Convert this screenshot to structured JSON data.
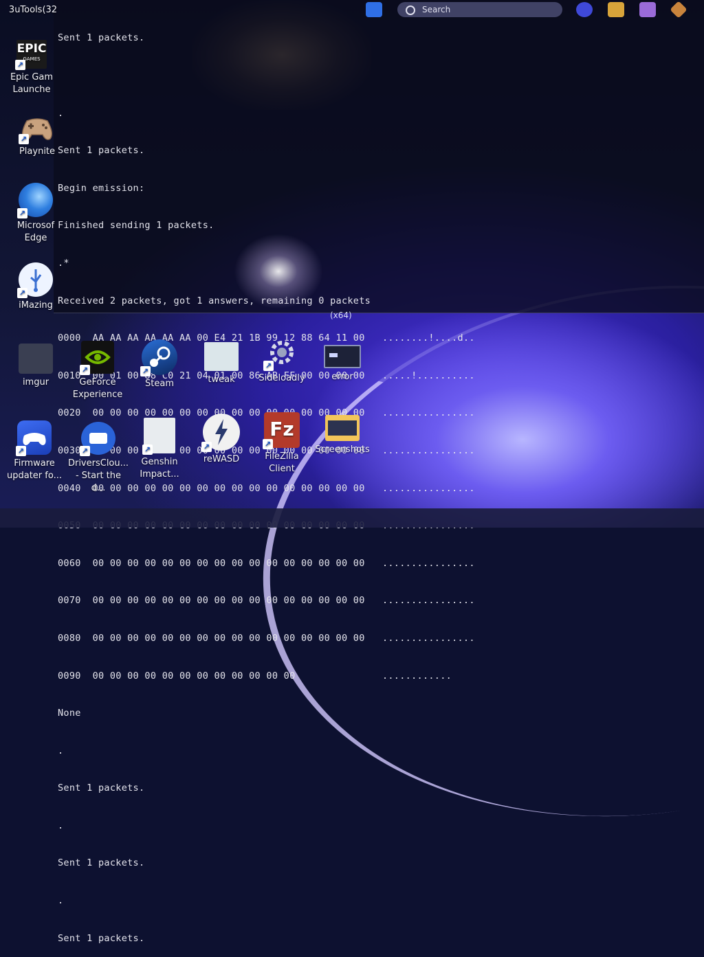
{
  "terminal": {
    "lines": [
      "Sent 1 packets.",
      "",
      ".",
      "Sent 1 packets.",
      "Begin emission:",
      "Finished sending 1 packets.",
      ".*",
      "Received 2 packets, got 1 answers, remaining 0 packets",
      "0000  AA AA AA AA AA AA 00 E4 21 1B 99 12 88 64 11 00   ........!....d..",
      "0010  00 01 00 88 C0 21 04 01 00 86 AB FF 00 00 00 00   .....!..........",
      "0020  00 00 00 00 00 00 00 00 00 00 00 00 00 00 00 00   ................",
      "0030  00 00 00 00 00 00 00 00 00 00 00 00 00 00 00 00   ................",
      "0040  00 00 00 00 00 00 00 00 00 00 00 00 00 00 00 00   ................",
      "0050  00 00 00 00 00 00 00 00 00 00 00 00 00 00 00 00   ................",
      "0060  00 00 00 00 00 00 00 00 00 00 00 00 00 00 00 00   ................",
      "0070  00 00 00 00 00 00 00 00 00 00 00 00 00 00 00 00   ................",
      "0080  00 00 00 00 00 00 00 00 00 00 00 00 00 00 00 00   ................",
      "0090  00 00 00 00 00 00 00 00 00 00 00 00               ............",
      "None",
      ".",
      "Sent 1 packets.",
      ".",
      "Sent 1 packets.",
      ".",
      "Sent 1 packets.",
      "."
    ],
    "window_label": "(x64)"
  },
  "desktop_left": [
    {
      "name": "3uTools(32",
      "icon": "3utools-icon"
    },
    {
      "name": "Epic Games Launcher",
      "label_line1": "Epic Gam",
      "label_line2": "Launche",
      "icon": "epic-games-icon",
      "logo_text": "EPIC",
      "logo_sub": "GAMES"
    },
    {
      "name": "Playnite",
      "icon": "playnite-icon"
    },
    {
      "name": "Microsoft Edge",
      "label_line1": "Microsof",
      "label_line2": "Edge",
      "icon": "edge-icon"
    },
    {
      "name": "iMazing",
      "icon": "imazing-icon"
    }
  ],
  "desktop_row1": [
    {
      "line1": "imgur",
      "line2": "",
      "icon": "imgur-icon"
    },
    {
      "line1": "GeForce",
      "line2": "Experience",
      "icon": "geforce-icon"
    },
    {
      "line1": "Steam",
      "line2": "",
      "icon": "steam-icon"
    },
    {
      "line1": "tweak",
      "line2": "",
      "icon": "tweak-icon"
    },
    {
      "line1": "Sideloadly",
      "line2": "",
      "icon": "sideloadly-icon"
    },
    {
      "line1": "error",
      "line2": "",
      "icon": "error-icon"
    }
  ],
  "desktop_row2": [
    {
      "line1": "Firmware",
      "line2": "updater fo...",
      "icon": "firmware-updater-icon"
    },
    {
      "line1": "DriversClou...",
      "line2": "- Start the d...",
      "icon": "driverscloud-icon"
    },
    {
      "line1": "Genshin",
      "line2": "Impact...",
      "icon": "genshin-icon"
    },
    {
      "line1": "reWASD",
      "line2": "",
      "icon": "rewasd-icon"
    },
    {
      "line1": "FileZilla",
      "line2": "Client",
      "icon": "filezilla-icon",
      "logo_text": "Fz"
    },
    {
      "line1": "Screenshots",
      "line2": "",
      "icon": "folder-icon"
    }
  ],
  "taskbar": {
    "search_label": "Search"
  }
}
